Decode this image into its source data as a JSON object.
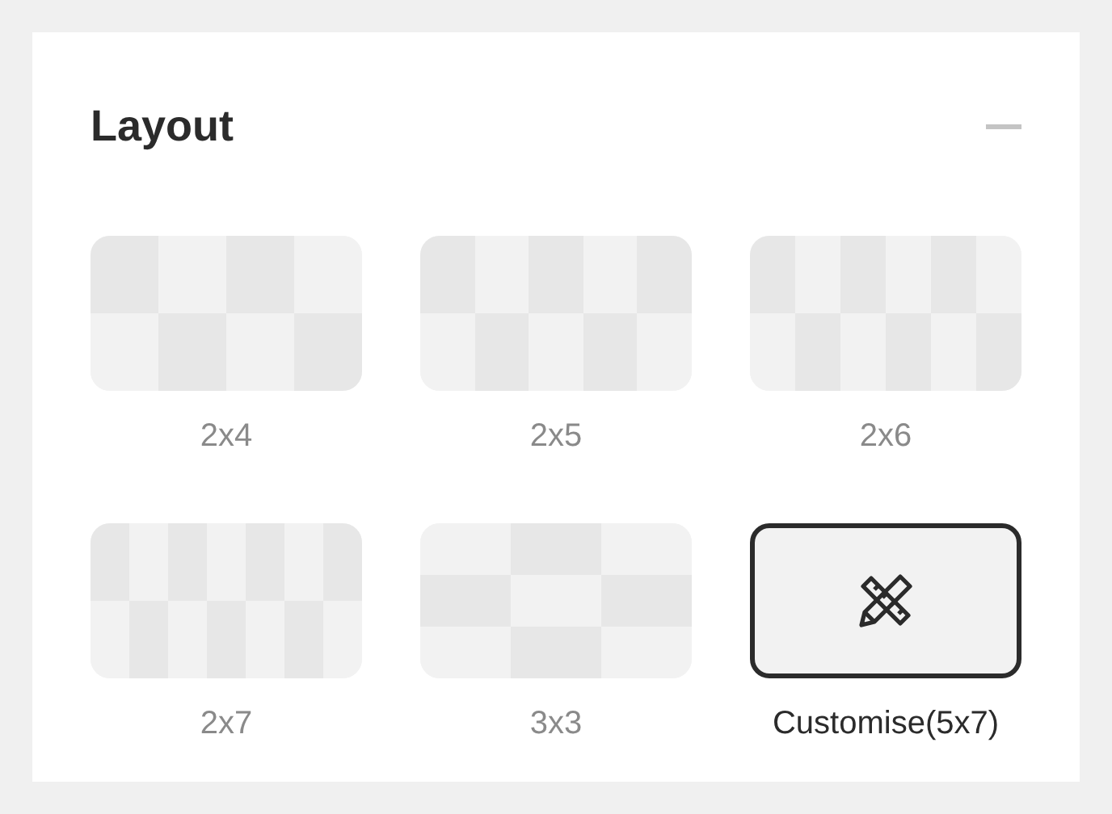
{
  "panel": {
    "title": "Layout",
    "expanded": true
  },
  "layouts": [
    {
      "kind": "grid",
      "label": "2x4",
      "selected": false
    },
    {
      "kind": "grid",
      "label": "2x5",
      "selected": false
    },
    {
      "kind": "grid",
      "label": "2x6",
      "selected": false
    },
    {
      "kind": "grid",
      "label": "2x7",
      "selected": false
    },
    {
      "kind": "grid",
      "label": "3x3",
      "selected": false
    },
    {
      "kind": "custom",
      "label": "Customise(5x7)",
      "selected": true
    }
  ]
}
